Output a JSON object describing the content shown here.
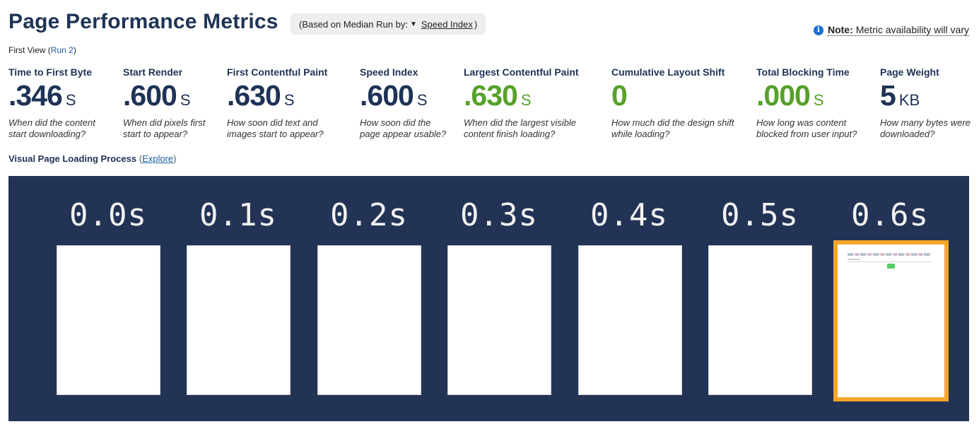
{
  "header": {
    "title": "Page Performance Metrics",
    "median_prefix": "(Based on Median Run by:",
    "median_selected": "Speed Index",
    "median_suffix": ")",
    "note_label": "Note:",
    "note_text": "Metric availability will vary"
  },
  "run": {
    "view_label": "First View",
    "run_link": "Run 2"
  },
  "metrics": [
    {
      "name": "Time to First Byte",
      "value": ".346",
      "unit": "S",
      "description": "When did the content start downloading?",
      "status": "neutral"
    },
    {
      "name": "Start Render",
      "value": ".600",
      "unit": "S",
      "description": "When did pixels first start to appear?",
      "status": "neutral"
    },
    {
      "name": "First Contentful Paint",
      "value": ".630",
      "unit": "S",
      "description": "How soon did text and images start to appear?",
      "status": "neutral"
    },
    {
      "name": "Speed Index",
      "value": ".600",
      "unit": "S",
      "description": "How soon did the page appear usable?",
      "status": "neutral"
    },
    {
      "name": "Largest Contentful Paint",
      "value": ".630",
      "unit": "S",
      "description": "When did the largest visible content finish loading?",
      "status": "good"
    },
    {
      "name": "Cumulative Layout Shift",
      "value": "0",
      "unit": "",
      "description": "How much did the design shift while loading?",
      "status": "good"
    },
    {
      "name": "Total Blocking Time",
      "value": ".000",
      "unit": "S",
      "description": "How long was content blocked from user input?",
      "status": "good"
    },
    {
      "name": "Page Weight",
      "value": "5",
      "unit": "KB",
      "description": "How many bytes were downloaded?",
      "status": "neutral"
    }
  ],
  "visual_progress": {
    "title": "Visual Page Loading Process",
    "explore_link": "Explore",
    "frames": [
      {
        "time": "0.0s",
        "state": "blank"
      },
      {
        "time": "0.1s",
        "state": "blank"
      },
      {
        "time": "0.2s",
        "state": "blank"
      },
      {
        "time": "0.3s",
        "state": "blank"
      },
      {
        "time": "0.4s",
        "state": "blank"
      },
      {
        "time": "0.5s",
        "state": "blank"
      },
      {
        "time": "0.6s",
        "state": "rendered"
      }
    ]
  },
  "colors": {
    "brand_navy": "#1e3355",
    "good_green": "#56a12a",
    "filmstrip_bg": "#223355",
    "highlight_orange": "#f7a72a",
    "link_blue": "#1a5fa0"
  }
}
